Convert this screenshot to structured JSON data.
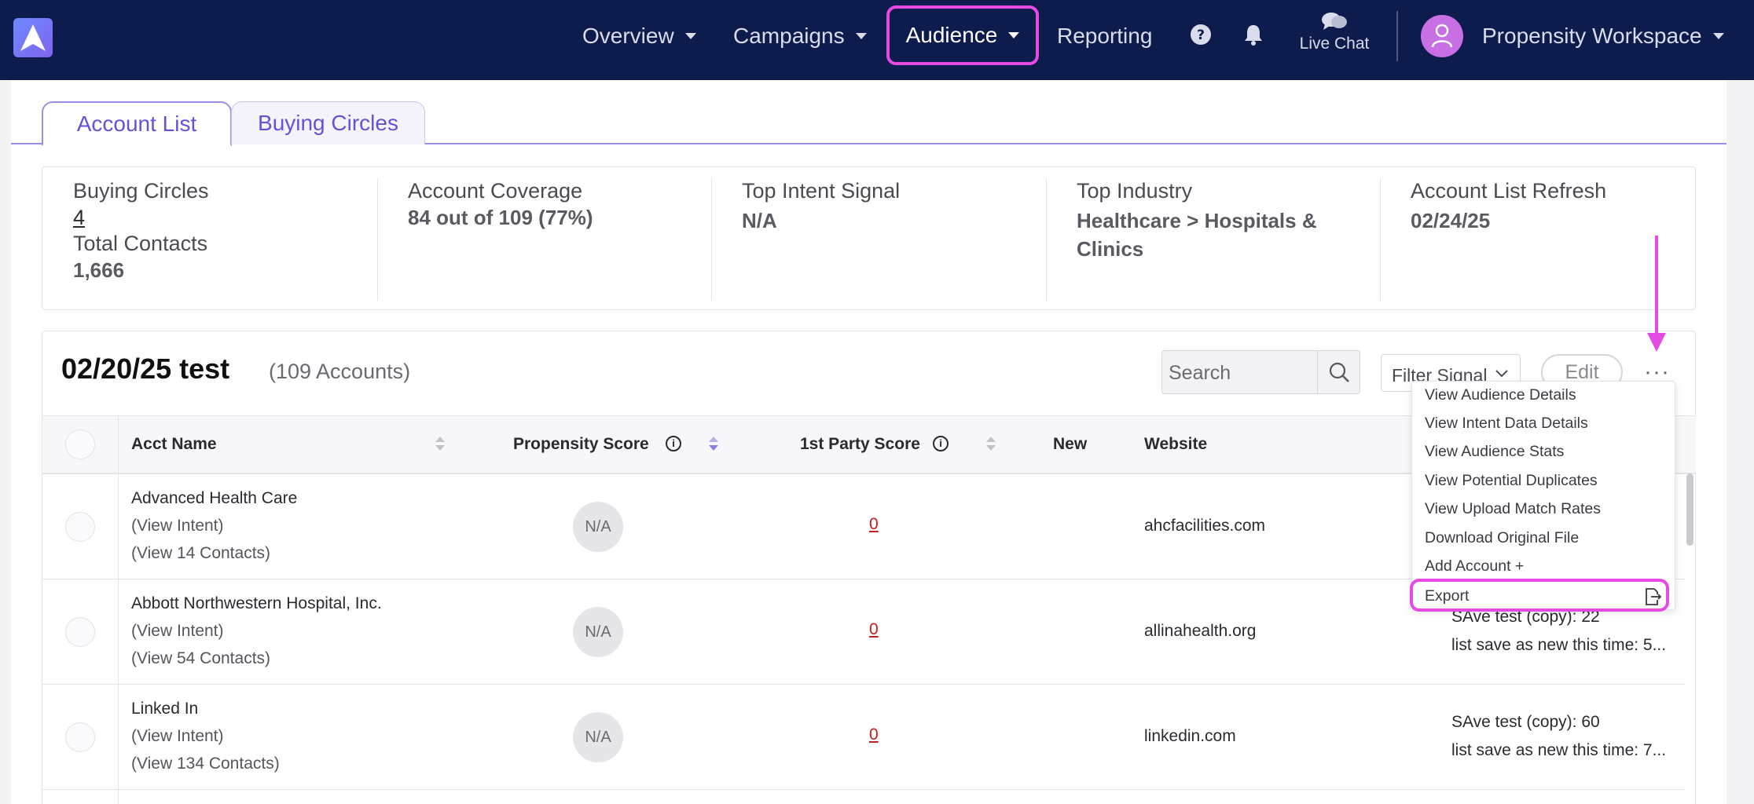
{
  "nav": {
    "items": [
      "Overview",
      "Campaigns",
      "Audience",
      "Reporting"
    ],
    "live_chat": "Live Chat",
    "workspace": "Propensity Workspace"
  },
  "tabs": [
    "Account List",
    "Buying Circles"
  ],
  "stats": {
    "buying_circles_label": "Buying Circles",
    "buying_circles_value": "4",
    "total_contacts_label": "Total Contacts",
    "total_contacts_value": "1,666",
    "coverage_label": "Account Coverage",
    "coverage_value": "84 out of 109 (77%)",
    "intent_label": "Top Intent Signal",
    "intent_value": "N/A",
    "industry_label": "Top Industry",
    "industry_value": "Healthcare > Hospitals & Clinics",
    "refresh_label": "Account List Refresh",
    "refresh_value": "02/24/25"
  },
  "list": {
    "title": "02/20/25 test",
    "count": "(109 Accounts)",
    "search_placeholder": "Search",
    "filter_label": "Filter Signal",
    "edit_label": "Edit",
    "more_label": "···"
  },
  "table": {
    "headers": {
      "acct_name": "Acct Name",
      "propensity": "Propensity Score",
      "first_party": "1st Party Score",
      "new": "New",
      "website": "Website"
    },
    "rows": [
      {
        "name": "Advanced Health Care",
        "intent": "(View Intent)",
        "contacts": "(View 14 Contacts)",
        "propensity": "N/A",
        "first_party": "0",
        "website": "ahcfacilities.com",
        "saved": []
      },
      {
        "name": "Abbott Northwestern Hospital, Inc.",
        "intent": "(View Intent)",
        "contacts": "(View 54 Contacts)",
        "propensity": "N/A",
        "first_party": "0",
        "website": "allinahealth.org",
        "saved": [
          "SAve test (copy): 22",
          "list save as new this time: 5..."
        ]
      },
      {
        "name": "Linked In",
        "intent": "(View Intent)",
        "contacts": "(View 134 Contacts)",
        "propensity": "N/A",
        "first_party": "0",
        "website": "linkedin.com",
        "saved": [
          "SAve test (copy): 60",
          "list save as new this time: 7..."
        ]
      }
    ]
  },
  "menu": {
    "items": [
      "View Audience Details",
      "View Intent Data Details",
      "View Audience Stats",
      "View Potential Duplicates",
      "View Upload Match Rates",
      "Download Original File",
      "Add Account +",
      "Export"
    ]
  },
  "colors": {
    "nav_bg": "#0e1b4d",
    "highlight": "#e54be3",
    "tab_accent": "#6552d8",
    "score_red": "#c11f1f"
  }
}
